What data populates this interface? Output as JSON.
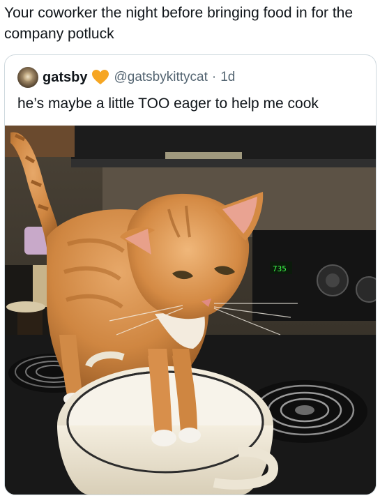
{
  "post": {
    "caption": "Your coworker the night before bringing food in for the company potluck"
  },
  "quoted_post": {
    "display_name": "gatsby",
    "badge_icon": "orange-heart-icon",
    "handle": "@gatsbykittycat",
    "separator": "·",
    "timestamp": "1d",
    "text": "he’s maybe a little TOO eager to help me cook",
    "image": {
      "subject": "cat-photo",
      "stove_display": "735"
    }
  },
  "colors": {
    "text_primary": "#0f1419",
    "text_secondary": "#536471",
    "card_border": "#cfd9de",
    "heart": "#f6a623"
  }
}
